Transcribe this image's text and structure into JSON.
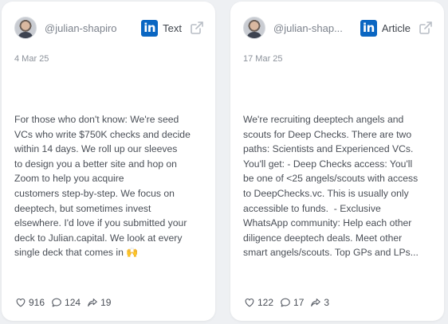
{
  "posts": [
    {
      "handle": "@julian-shapiro",
      "platform_icon": "linkedin-icon",
      "type": "Text",
      "date": "4 Mar 25",
      "body": "For those who don't know: We're seed\nVCs who write $750K checks and decide\nwithin 14 days. We roll up our sleeves\nto design you a better site and hop on\nZoom to help you acquire\ncustomers step-by-step. We focus on\ndeeptech, but sometimes invest\nelsewhere. I'd love if you submitted your\ndeck to Julian.capital. We look at every\nsingle deck that comes in 🙌",
      "likes": "916",
      "comments": "124",
      "shares": "19"
    },
    {
      "handle": "@julian-shap...",
      "platform_icon": "linkedin-icon",
      "type": "Article",
      "date": "17 Mar 25",
      "body": "We're recruiting deeptech angels and\nscouts for Deep Checks. There are two\npaths: Scientists and Experienced VCs.\nYou'll get: - Deep Checks access: You'll\nbe one of <25 angels/scouts with access\nto DeepChecks.vc. This is usually only\naccessible to funds.  - Exclusive\nWhatsApp community: Help each other\ndiligence deeptech deals. Meet other\nsmart angels/scouts. Top GPs and LPs...",
      "likes": "122",
      "comments": "17",
      "shares": "3"
    }
  ],
  "colors": {
    "linkedin": "#0a66c2",
    "background": "#eef0f3",
    "card": "#ffffff"
  }
}
